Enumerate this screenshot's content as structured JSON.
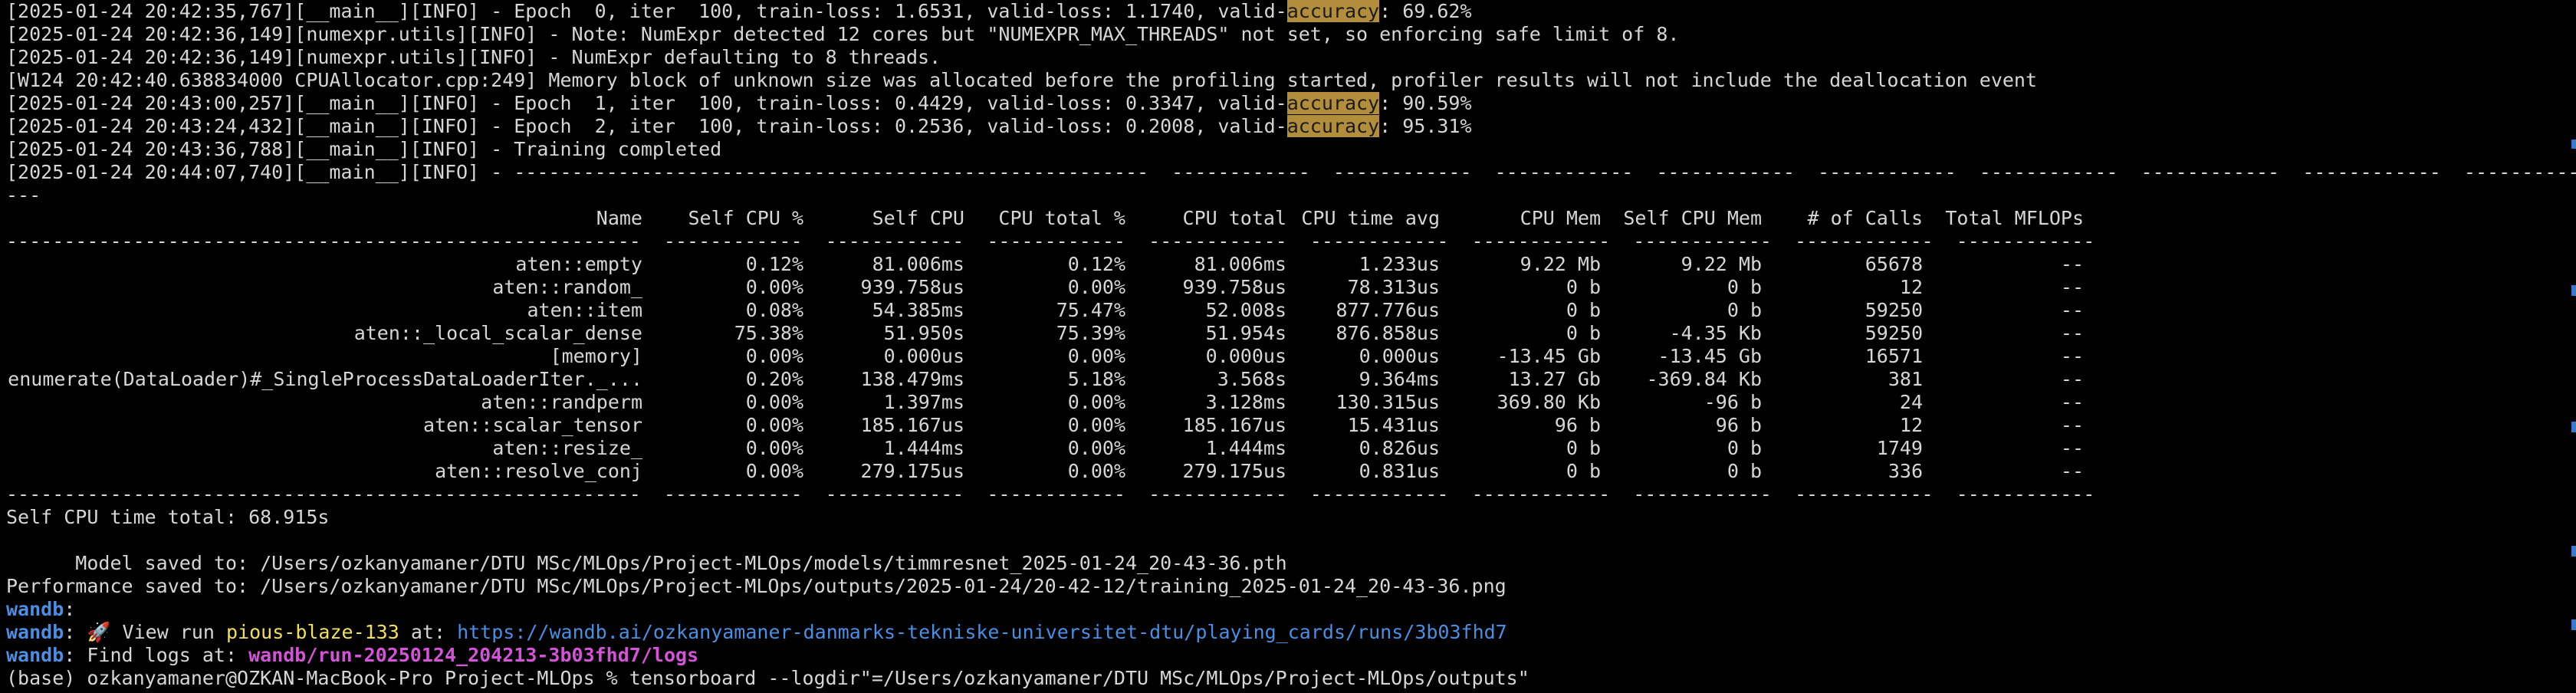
{
  "log_lines": [
    {
      "parts": [
        {
          "t": "[2025-01-24 20:42:35,767][__main__][INFO] - Epoch  0, iter  100, train-loss: 1.6531, valid-loss: 1.1740, valid-"
        },
        {
          "t": "accuracy",
          "hl": true
        },
        {
          "t": ": 69.62%"
        }
      ]
    },
    {
      "parts": [
        {
          "t": "[2025-01-24 20:42:36,149][numexpr.utils][INFO] - Note: NumExpr detected 12 cores but \"NUMEXPR_MAX_THREADS\" not set, so enforcing safe limit of 8."
        }
      ]
    },
    {
      "parts": [
        {
          "t": "[2025-01-24 20:42:36,149][numexpr.utils][INFO] - NumExpr defaulting to 8 threads."
        }
      ]
    },
    {
      "parts": [
        {
          "t": "[W124 20:42:40.638834000 CPUAllocator.cpp:249] Memory block of unknown size was allocated before the profiling started, profiler results will not include the deallocation event"
        }
      ]
    },
    {
      "parts": [
        {
          "t": "[2025-01-24 20:43:00,257][__main__][INFO] - Epoch  1, iter  100, train-loss: 0.4429, valid-loss: 0.3347, valid-"
        },
        {
          "t": "accuracy",
          "hl": true
        },
        {
          "t": ": 90.59%"
        }
      ]
    },
    {
      "parts": [
        {
          "t": "[2025-01-24 20:43:24,432][__main__][INFO] - Epoch  2, iter  100, train-loss: 0.2536, valid-loss: 0.2008, valid-"
        },
        {
          "t": "accuracy",
          "hl": true
        },
        {
          "t": ": 95.31%"
        }
      ]
    },
    {
      "parts": [
        {
          "t": "[2025-01-24 20:43:36,788][__main__][INFO] - Training completed"
        }
      ]
    },
    {
      "parts": [
        {
          "t": "[2025-01-24 20:44:07,740][__main__][INFO] - -------------------------------------------------------  ------------  ------------  ------------  ------------  ------------  ------------  ------------  ------------  ------------"
        }
      ]
    },
    {
      "parts": [
        {
          "t": "---"
        }
      ]
    }
  ],
  "profiler": {
    "headers": [
      "Name",
      "Self CPU %",
      "Self CPU",
      "CPU total %",
      "CPU total",
      "CPU time avg",
      "CPU Mem",
      "Self CPU Mem",
      "# of Calls",
      "Total MFLOPs"
    ],
    "separator": "-------------------------------------------------------  ------------  ------------  ------------  ------------  ------------  ------------  ------------  ------------  ------------",
    "rows": [
      [
        "aten::empty",
        "0.12%",
        "81.006ms",
        "0.12%",
        "81.006ms",
        "1.233us",
        "9.22 Mb",
        "9.22 Mb",
        "65678",
        "--"
      ],
      [
        "aten::random_",
        "0.00%",
        "939.758us",
        "0.00%",
        "939.758us",
        "78.313us",
        "0 b",
        "0 b",
        "12",
        "--"
      ],
      [
        "aten::item",
        "0.08%",
        "54.385ms",
        "75.47%",
        "52.008s",
        "877.776us",
        "0 b",
        "0 b",
        "59250",
        "--"
      ],
      [
        "aten::_local_scalar_dense",
        "75.38%",
        "51.950s",
        "75.39%",
        "51.954s",
        "876.858us",
        "0 b",
        "-4.35 Kb",
        "59250",
        "--"
      ],
      [
        "[memory]",
        "0.00%",
        "0.000us",
        "0.00%",
        "0.000us",
        "0.000us",
        "-13.45 Gb",
        "-13.45 Gb",
        "16571",
        "--"
      ],
      [
        "enumerate(DataLoader)#_SingleProcessDataLoaderIter._...",
        "0.20%",
        "138.479ms",
        "5.18%",
        "3.568s",
        "9.364ms",
        "13.27 Gb",
        "-369.84 Kb",
        "381",
        "--"
      ],
      [
        "aten::randperm",
        "0.00%",
        "1.397ms",
        "0.00%",
        "3.128ms",
        "130.315us",
        "369.80 Kb",
        "-96 b",
        "24",
        "--"
      ],
      [
        "aten::scalar_tensor",
        "0.00%",
        "185.167us",
        "0.00%",
        "185.167us",
        "15.431us",
        "96 b",
        "96 b",
        "12",
        "--"
      ],
      [
        "aten::resize_",
        "0.00%",
        "1.444ms",
        "0.00%",
        "1.444ms",
        "0.826us",
        "0 b",
        "0 b",
        "1749",
        "--"
      ],
      [
        "aten::resolve_conj",
        "0.00%",
        "279.175us",
        "0.00%",
        "279.175us",
        "0.831us",
        "0 b",
        "0 b",
        "336",
        "--"
      ]
    ],
    "total": "Self CPU time total: 68.915s"
  },
  "saved": {
    "model": "      Model saved to: /Users/ozkanyamaner/DTU MSc/MLOps/Project-MLOps/models/timmresnet_2025-01-24_20-43-36.pth",
    "performance": "Performance saved to: /Users/ozkanyamaner/DTU MSc/MLOps/Project-MLOps/outputs/2025-01-24/20-42-12/training_2025-01-24_20-43-36.png"
  },
  "wandb": {
    "prefix": "wandb",
    "view_run_text": ": 🚀 View run ",
    "run_name": "pious-blaze-133",
    "at_text": " at: ",
    "run_url": "https://wandb.ai/ozkanyamaner-danmarks-tekniske-universitet-dtu/playing_cards/runs/3b03fhd7",
    "find_logs_text": ": Find logs at: ",
    "logs_path": "wandb/run-20250124_204213-3b03fhd7/logs"
  },
  "prompt": {
    "text": "(base) ozkanyamaner@OZKAN-MacBook-Pro Project-MLOps % tensorboard --logdir\"=/Users/ozkanyamaner/DTU MSc/MLOps/Project-MLOps/outputs\""
  },
  "colors": {
    "background": "#000000",
    "foreground": "#d6d6d6",
    "highlight": "#b28e3c",
    "wandb_blue": "#4a8fe3",
    "run_name_yellow": "#f2e05a",
    "logs_magenta": "#d553d8"
  }
}
